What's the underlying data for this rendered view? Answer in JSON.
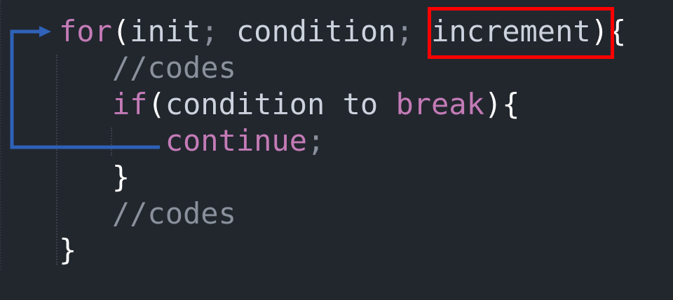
{
  "code": {
    "line1": {
      "kw": "for",
      "open": "(",
      "init": "init",
      "semi1": ";",
      "cond": " condition",
      "semi2": ";",
      "incr": " increment",
      "close": ")",
      "brace": "{"
    },
    "line2": {
      "comment": "   //codes"
    },
    "line3": {
      "indent": "   ",
      "kw": "if",
      "open": "(",
      "cond": "condition to ",
      "kw2": "break",
      "close": ")",
      "brace": "{"
    },
    "line4": {
      "indent": "      ",
      "kw": "continue",
      "semi": ";"
    },
    "line5": {
      "brace": "   }"
    },
    "line6": {
      "comment": "   //codes"
    },
    "line7": {
      "brace": "}"
    }
  },
  "colors": {
    "highlight_box": "#ff0000",
    "arrow": "#2f62b8",
    "keyword": "#c47bb7",
    "background": "#22272e"
  }
}
